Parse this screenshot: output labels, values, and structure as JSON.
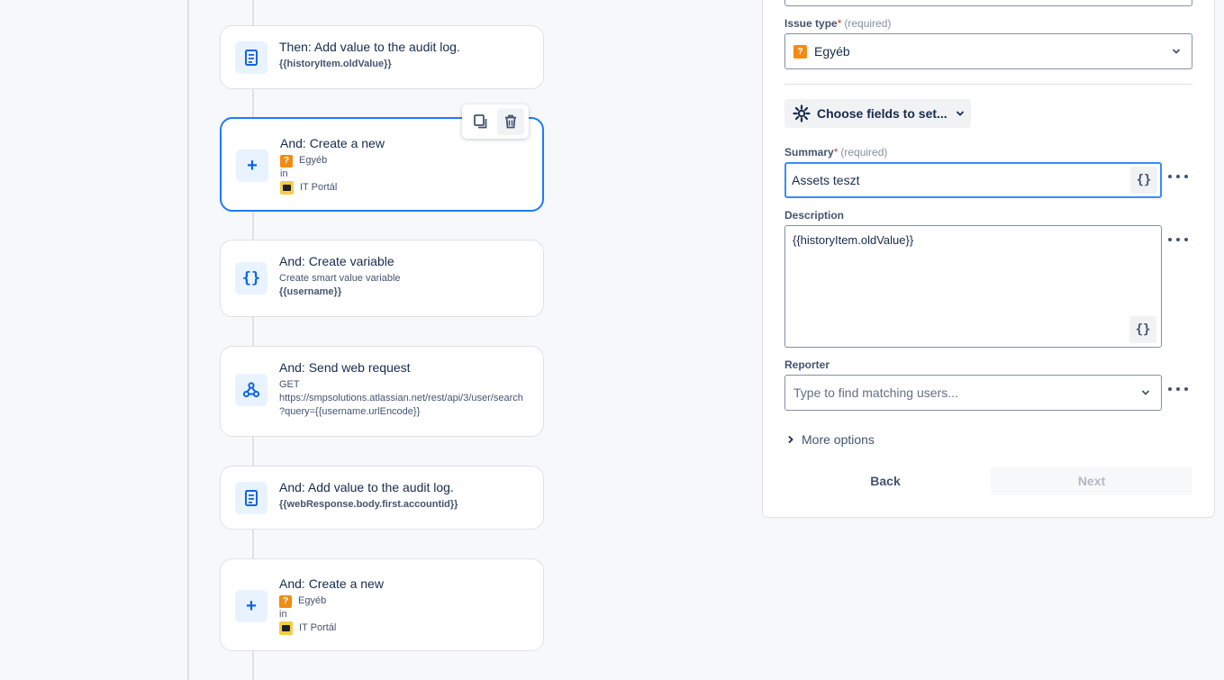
{
  "canvas": {
    "toolbar": {
      "duplicate_icon": "copy-icon",
      "delete_icon": "trash-icon"
    },
    "rules": [
      {
        "title": "Then: Add value to the audit log.",
        "lines": [
          "{{historyItem.oldValue}}"
        ]
      },
      {
        "title": "And: Create a new",
        "issue_type": "Egyéb",
        "in": "in",
        "project": "IT Portál"
      },
      {
        "title": "And: Create variable",
        "lines": [
          "Create smart value variable",
          "{{username}}"
        ]
      },
      {
        "title": "And: Send web request",
        "lines": [
          "GET",
          "https://smpsolutions.atlassian.net/rest/api/3/user/search",
          "?query={{username.urlEncode}}"
        ]
      },
      {
        "title": "And: Add value to the audit log.",
        "lines": [
          "{{webResponse.body.first.accountid}}"
        ]
      },
      {
        "title": "And: Create a new",
        "issue_type": "Egyéb",
        "in": "in",
        "project": "IT Portál"
      }
    ]
  },
  "panel": {
    "issue_type": {
      "label": "Issue type",
      "required_mark": "*",
      "required_text": "(required)",
      "value": "Egyéb"
    },
    "choose_fields": {
      "label": "Choose fields to set..."
    },
    "summary": {
      "label": "Summary",
      "required_mark": "*",
      "required_text": "(required)",
      "value": "Assets teszt"
    },
    "description": {
      "label": "Description",
      "value": "{{historyItem.oldValue}}"
    },
    "reporter": {
      "label": "Reporter",
      "placeholder": "Type to find matching users..."
    },
    "more_options": "More options",
    "back": "Back",
    "next": "Next",
    "curly_label": "{}",
    "colors": {
      "accent": "#1d7afc",
      "focus": "#388bff",
      "issue_type_icon": "#f18d13",
      "project_icon": "#f5cd47"
    }
  }
}
